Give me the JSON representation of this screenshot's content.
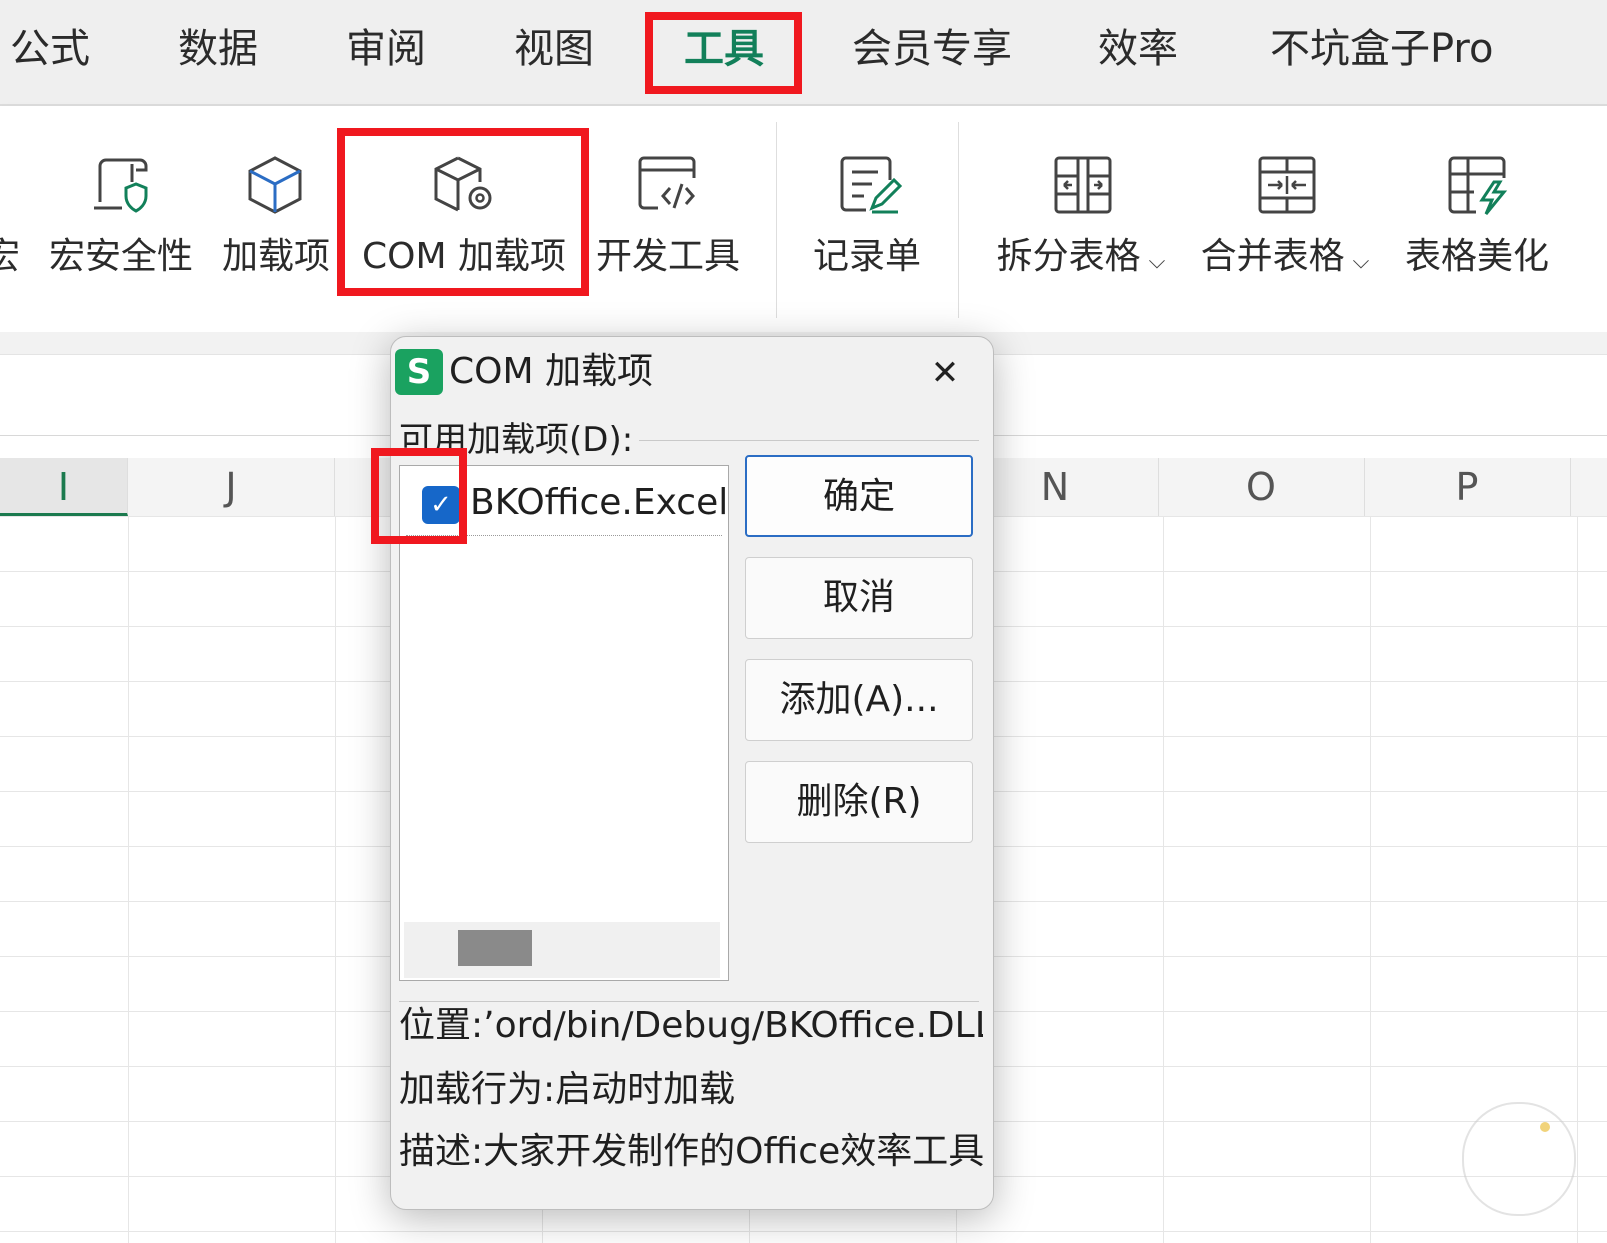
{
  "menu": {
    "tabs": [
      {
        "label": "公式"
      },
      {
        "label": "数据"
      },
      {
        "label": "审阅"
      },
      {
        "label": "视图"
      },
      {
        "label": "工具",
        "active": true
      },
      {
        "label": "会员专享"
      },
      {
        "label": "效率"
      },
      {
        "label": "不坑盒子Pro"
      }
    ]
  },
  "ribbon": {
    "partial_label": "宏",
    "items": [
      {
        "label": "宏安全性",
        "icon": "macro-security-icon"
      },
      {
        "label": "加载项",
        "icon": "addin-cube-icon"
      },
      {
        "label": "COM 加载项",
        "icon": "com-addin-icon"
      },
      {
        "label": "开发工具",
        "icon": "developer-code-icon"
      },
      {
        "label": "记录单",
        "icon": "record-form-icon"
      },
      {
        "label": "拆分表格",
        "icon": "split-table-icon",
        "dropdown": true
      },
      {
        "label": "合并表格",
        "icon": "merge-table-icon",
        "dropdown": true
      },
      {
        "label": "表格美化",
        "icon": "beautify-table-icon"
      }
    ]
  },
  "sheet": {
    "columns": [
      "I",
      "J",
      "N",
      "O",
      "P"
    ],
    "selected_column": "I"
  },
  "dialog": {
    "title": "COM 加载项",
    "logo": "S",
    "group_label": "可用加载项(D):",
    "addins": [
      {
        "name": "BKOffice.Excel",
        "checked": true
      }
    ],
    "buttons": {
      "ok": "确定",
      "cancel": "取消",
      "add": "添加(A)...",
      "remove": "删除(R)"
    },
    "location": "位置:’ord/bin/Debug/BKOffice.DLL",
    "load_behavior": "加载行为:启动时加载",
    "description": "描述:大家开发制作的Office效率工具"
  },
  "colors": {
    "accent": "#12805a",
    "highlight_box": "#f0181f",
    "checkbox": "#1667c9",
    "logo": "#1aa260"
  }
}
